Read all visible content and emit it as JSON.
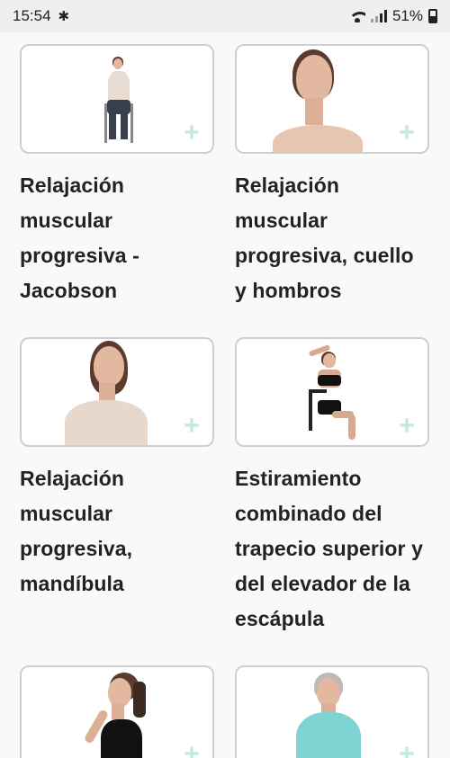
{
  "status": {
    "time": "15:54",
    "battery": "51%"
  },
  "cards": [
    {
      "title": "Relajación muscular progresiva - Jacobson"
    },
    {
      "title": "Relajación muscular progresiva,  cuello y hombros"
    },
    {
      "title": "Relajación muscular progresiva, mandíbula"
    },
    {
      "title": "Estiramiento combinado del trapecio superior y del elevador de la escápula"
    },
    {
      "title": ""
    },
    {
      "title": ""
    }
  ],
  "accent_color": "#bfe9e1"
}
